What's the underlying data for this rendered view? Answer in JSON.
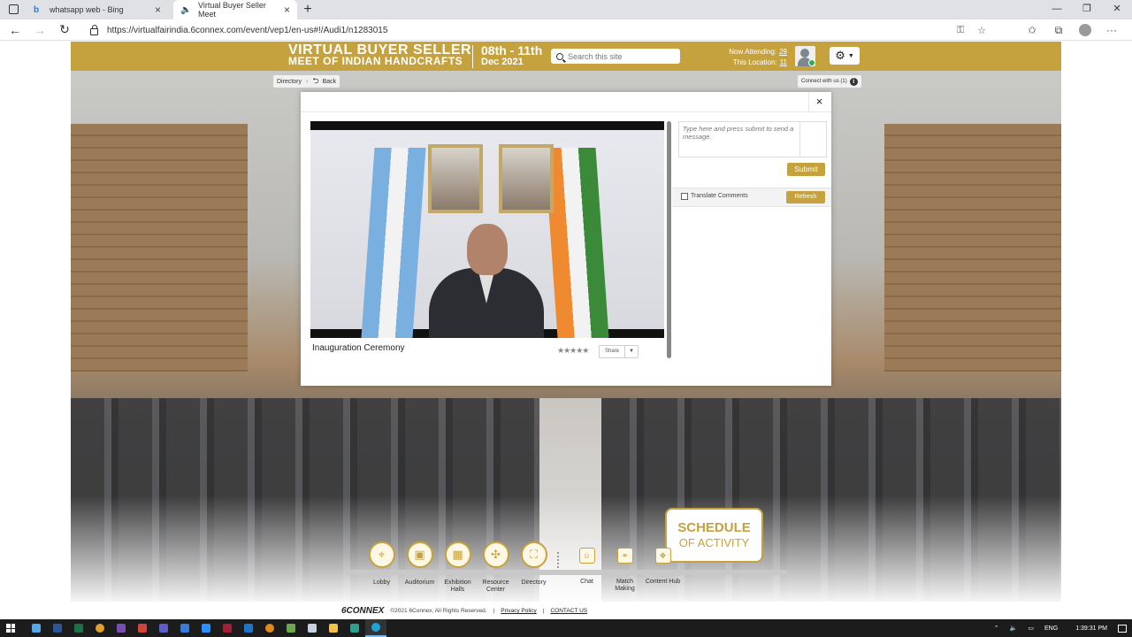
{
  "browser": {
    "tabs": [
      {
        "label": "whatsapp web - Bing",
        "active": false
      },
      {
        "label": "Virtual Buyer Seller Meet",
        "active": true
      }
    ],
    "new_tab": "+",
    "url": "https://virtualfairindia.6connex.com/event/vep1/en-us#!/Audi1/n1283015"
  },
  "header": {
    "title_line1": "VIRTUAL BUYER SELLER",
    "title_line2": "MEET OF INDIAN HANDCRAFTS",
    "date_line1": "08th - 11th",
    "date_line2": "Dec 2021",
    "search_placeholder": "Search this site",
    "now_attending_label": "Now Attending:",
    "now_attending_value": "29",
    "this_location_label": "This Location:",
    "this_location_value": "11"
  },
  "breadcrumb": {
    "directory": "Directory",
    "back": "Back",
    "connect": "Connect with us (1)"
  },
  "modal": {
    "close": "×",
    "video_title": "Inauguration Ceremony",
    "rating_stars": "★★★★★",
    "share_label": "Share",
    "chat_placeholder": "Type here and press submit to send a message.",
    "submit_label": "Submit",
    "translate_label": "Translate Comments",
    "refresh_label": "Refresh"
  },
  "schedule": {
    "line1": "SCHEDULE",
    "line2": "OF ACTIVITY"
  },
  "nav": [
    {
      "label": "Lobby",
      "icon": "location-pin-icon"
    },
    {
      "label": "Auditorium",
      "icon": "auditorium-icon"
    },
    {
      "label": "Exhibition Halls",
      "icon": "exhibition-icon"
    },
    {
      "label": "Resource Center",
      "icon": "resource-icon"
    },
    {
      "label": "Directory",
      "icon": "map-icon"
    },
    {
      "label": "Chat",
      "icon": "chat-icon"
    },
    {
      "label": "Match Making",
      "icon": "handshake-icon"
    },
    {
      "label": "Content Hub",
      "icon": "content-icon"
    }
  ],
  "footer": {
    "logo": "6CONNEX",
    "copyright": "©2021 6Connex, All Rights Reserved.",
    "privacy": "Privacy Policy",
    "contact": "CONTACT US"
  },
  "taskbar": {
    "lang": "ENG",
    "time": "1:39:31 PM"
  }
}
